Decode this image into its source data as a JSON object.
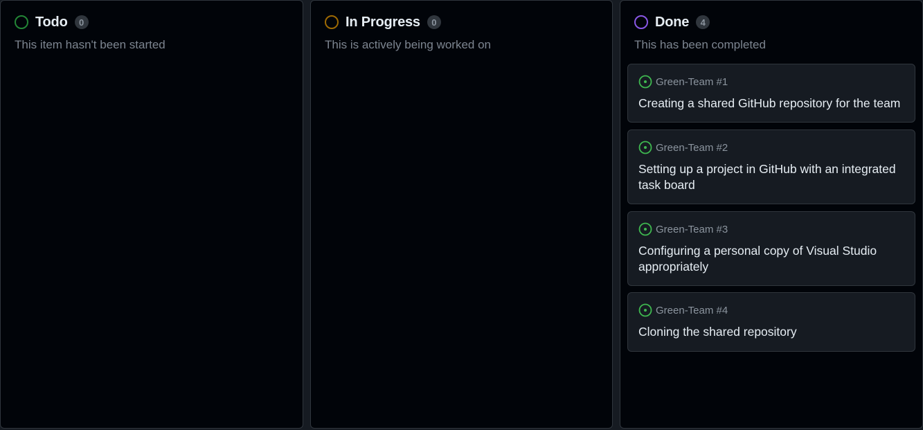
{
  "columns": [
    {
      "title": "Todo",
      "count": "0",
      "description": "This item hasn't been started",
      "color": "#238636",
      "cards": []
    },
    {
      "title": "In Progress",
      "count": "0",
      "description": "This is actively being worked on",
      "color": "#9e6a03",
      "cards": []
    },
    {
      "title": "Done",
      "count": "4",
      "description": "This has been completed",
      "color": "#8957e5",
      "cards": [
        {
          "ref": "Green-Team #1",
          "title": "Creating a shared GitHub repository for the team",
          "icon": "issue-open-icon"
        },
        {
          "ref": "Green-Team #2",
          "title": "Setting up a project in GitHub with an integrated task board",
          "icon": "issue-open-icon"
        },
        {
          "ref": "Green-Team #3",
          "title": "Configuring a personal copy of Visual Studio appropriately",
          "icon": "issue-open-icon"
        },
        {
          "ref": "Green-Team #4",
          "title": "Cloning the shared repository",
          "icon": "issue-open-icon"
        }
      ]
    }
  ],
  "colors": {
    "issue_open": "#3fb950"
  }
}
